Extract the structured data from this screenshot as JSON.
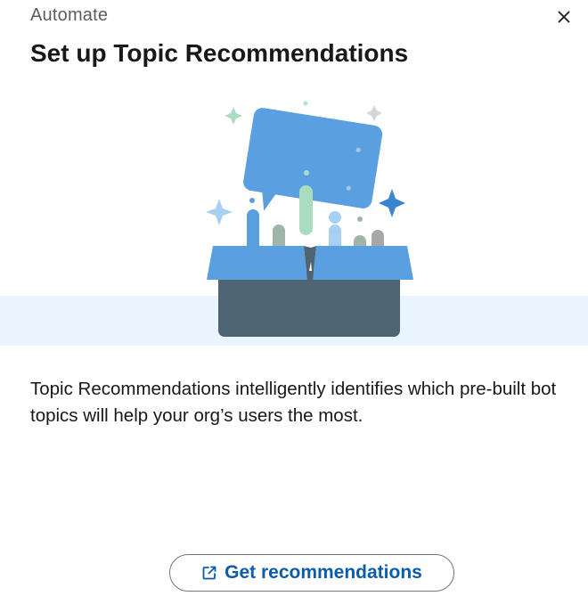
{
  "header": {
    "eyebrow": "Automate",
    "title": "Set up Topic Recommendations",
    "close_icon": "close-icon"
  },
  "hero": {
    "illustration": "box-with-speech-bubble-illustration",
    "colors": {
      "bubble": "#5a9fe0",
      "box_flaps": "#5a9fe0",
      "box_body": "#4f6472",
      "band": "#eaf4fe",
      "sparkle_green": "#a9dcc0",
      "sparkle_gray": "#d6d6d6"
    }
  },
  "body": {
    "description": "Topic Recommendations intelligently identifies which pre-built bot topics will help your org’s users the most."
  },
  "actions": {
    "primary_label": "Get recommendations",
    "primary_icon": "external-link-icon",
    "accent_color": "#0b5cab"
  }
}
